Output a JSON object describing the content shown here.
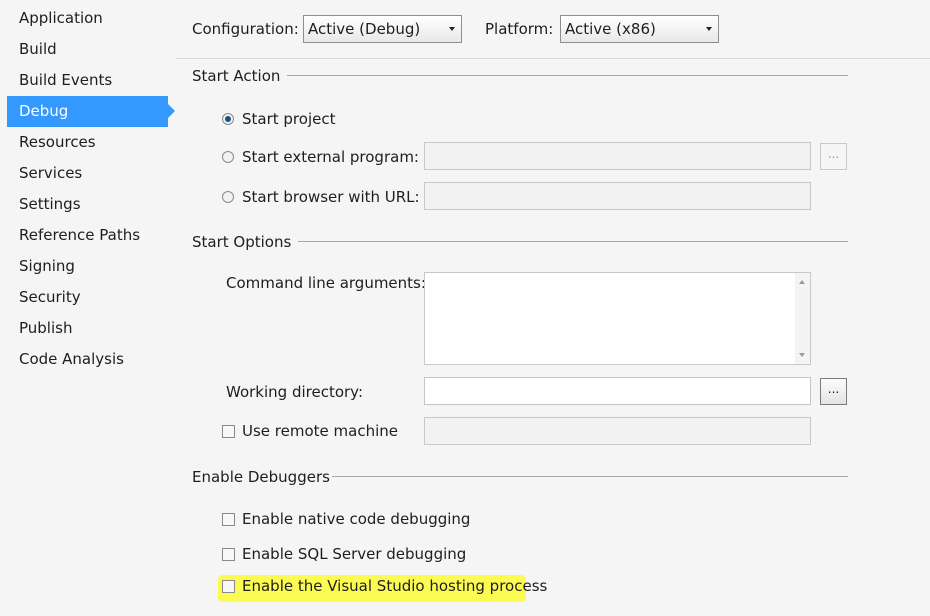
{
  "sidebar": {
    "items": [
      {
        "label": "Application"
      },
      {
        "label": "Build"
      },
      {
        "label": "Build Events"
      },
      {
        "label": "Debug"
      },
      {
        "label": "Resources"
      },
      {
        "label": "Services"
      },
      {
        "label": "Settings"
      },
      {
        "label": "Reference Paths"
      },
      {
        "label": "Signing"
      },
      {
        "label": "Security"
      },
      {
        "label": "Publish"
      },
      {
        "label": "Code Analysis"
      }
    ],
    "active_label": "Debug"
  },
  "header": {
    "configuration_label": "Configuration:",
    "configuration_value": "Active (Debug)",
    "platform_label": "Platform:",
    "platform_value": "Active (x86)"
  },
  "start_action": {
    "title": "Start Action",
    "start_project": "Start project",
    "start_external_program": "Start external program:",
    "start_browser_url": "Start browser with URL:",
    "selected": "Start project",
    "browse_label": "..."
  },
  "start_options": {
    "title": "Start Options",
    "command_line_label": "Command line arguments:",
    "working_directory_label": "Working directory:",
    "use_remote_machine_label": "Use remote machine",
    "browse_label": "..."
  },
  "enable_debuggers": {
    "title": "Enable Debuggers",
    "native_label": "Enable native code debugging",
    "sql_label": "Enable SQL Server debugging",
    "hosting_label": "Enable the Visual Studio hosting process"
  },
  "colors": {
    "active_nav": "#3399ff",
    "highlight": "#fbfb52"
  }
}
